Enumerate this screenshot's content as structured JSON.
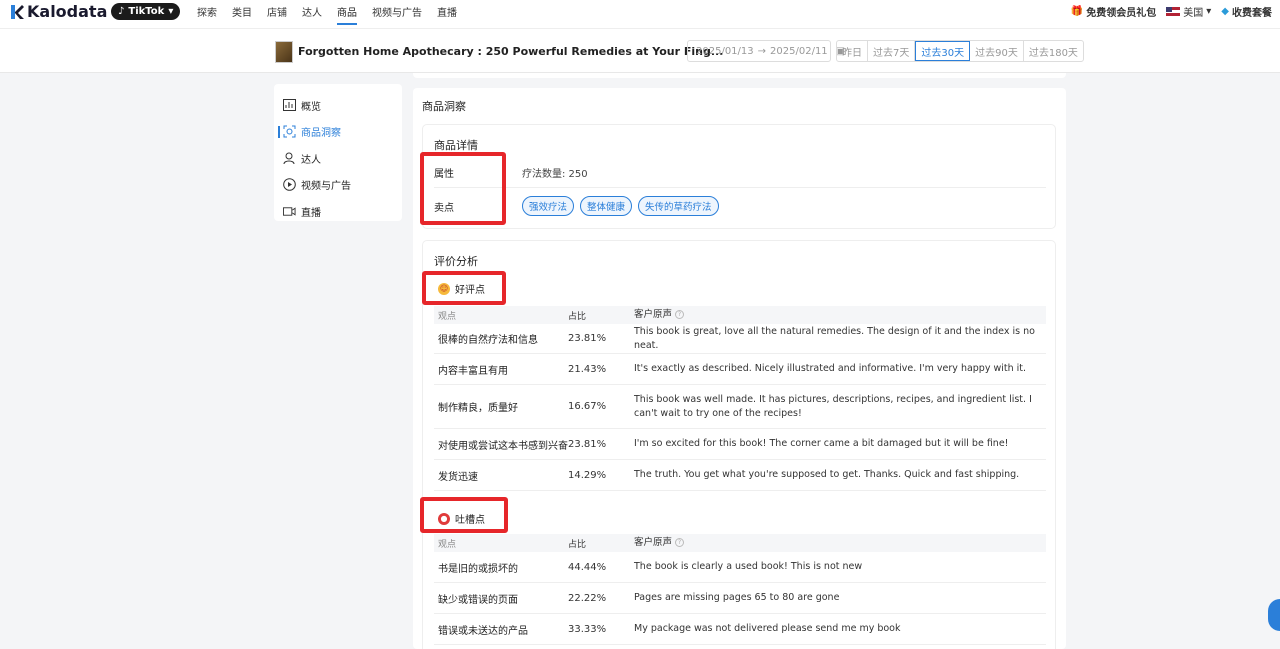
{
  "nav": {
    "brand": "Kalodata",
    "platform": "TikTok",
    "links": [
      "探索",
      "类目",
      "店铺",
      "达人",
      "商品",
      "视频与广告",
      "直播"
    ],
    "active_index": 4,
    "right": {
      "gift": "免费领会员礼包",
      "region": "美国",
      "pricing": "收费套餐"
    }
  },
  "product": {
    "title": "Forgotten Home Apothecary : 250 Powerful Remedies at Your Fing...",
    "date_start": "2025/01/13",
    "date_sep": "→",
    "date_end": "2025/02/11",
    "ranges": [
      "昨日",
      "过去7天",
      "过去30天",
      "过去90天",
      "过去180天"
    ],
    "active_range": 2
  },
  "sidebar": {
    "items": [
      {
        "label": "概览",
        "icon": "chart-icon"
      },
      {
        "label": "商品洞察",
        "icon": "insight-icon"
      },
      {
        "label": "达人",
        "icon": "user-icon"
      },
      {
        "label": "视频与广告",
        "icon": "play-icon"
      },
      {
        "label": "直播",
        "icon": "video-icon"
      }
    ],
    "active_index": 1
  },
  "main": {
    "title": "商品洞察",
    "detail": {
      "title": "商品详情",
      "attr_key": "属性",
      "attr_value": "疗法数量: 250",
      "selling_key": "卖点",
      "selling_tags": [
        "强效疗法",
        "整体健康",
        "失传的草药疗法"
      ]
    },
    "review": {
      "title": "评价分析",
      "good_label": "好评点",
      "bad_label": "吐槽点",
      "columns": [
        "观点",
        "占比",
        "客户原声"
      ],
      "good_rows": [
        {
          "point": "很棒的自然疗法和信息",
          "pct": "23.81%",
          "quote": "This book is great, love all the natural remedies. The design of it and the index is no neat."
        },
        {
          "point": "内容丰富且有用",
          "pct": "21.43%",
          "quote": "It's exactly as described. Nicely illustrated and informative. I'm very happy with it."
        },
        {
          "point": "制作精良，质量好",
          "pct": "16.67%",
          "quote": "This book was well made. It has pictures, descriptions, recipes, and ingredient list. I can't wait to try one of the recipes!"
        },
        {
          "point": "对使用或尝试这本书感到兴奋",
          "pct": "23.81%",
          "quote": "I'm so excited for this book! The corner came a bit damaged but it will be fine!"
        },
        {
          "point": "发货迅速",
          "pct": "14.29%",
          "quote": "The truth. You get what you're supposed to get. Thanks. Quick and fast shipping."
        }
      ],
      "bad_rows": [
        {
          "point": "书是旧的或损坏的",
          "pct": "44.44%",
          "quote": "The book is clearly a used book! This is not new"
        },
        {
          "point": "缺少或错误的页面",
          "pct": "22.22%",
          "quote": "Pages are missing pages 65 to 80 are gone"
        },
        {
          "point": "错误或未送达的产品",
          "pct": "33.33%",
          "quote": "My package was not delivered please send me my book"
        }
      ]
    }
  },
  "colors": {
    "accent": "#2b7fd9",
    "highlight": "#e6262a"
  }
}
